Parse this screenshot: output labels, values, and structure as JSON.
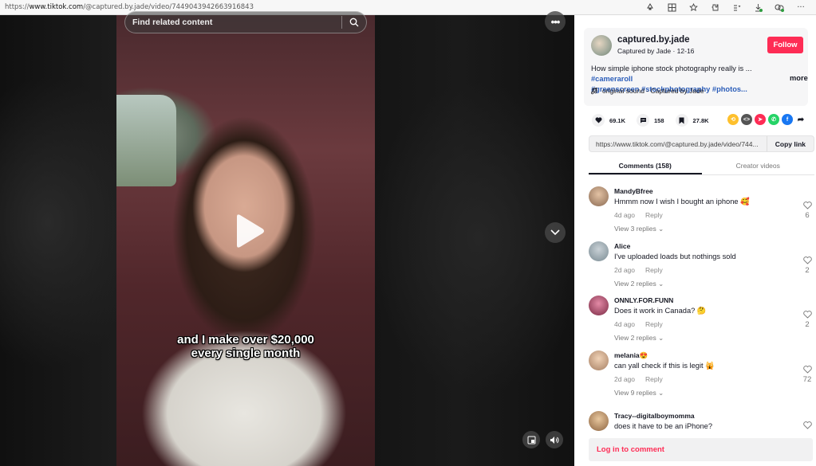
{
  "browser": {
    "url_prefix": "https://",
    "url_host": "www.tiktok.com",
    "url_path": "/@captured.by.jade/video/7449043942663916843"
  },
  "video": {
    "search_placeholder": "Find related content",
    "caption_line1": "and I make over $20,000",
    "caption_line2": "every single month"
  },
  "post": {
    "username": "captured.by.jade",
    "subline": "Captured by Jade · 12-16",
    "follow_label": "Follow",
    "desc_text": "How simple iphone stock photography really is ... ",
    "tags_line1": "#cameraroll",
    "tags_line2": "#greenscreen #stockphotography #photos...",
    "more_label": "more",
    "sound": "original sound - Captured by Jade"
  },
  "stats": {
    "likes": "69.1K",
    "comments": "158",
    "saves": "27.8K"
  },
  "share": {
    "link": "https://www.tiktok.com/@captured.by.jade/video/744...",
    "copy_label": "Copy link"
  },
  "tabs": [
    {
      "label": "Comments (158)"
    },
    {
      "label": "Creator videos"
    }
  ],
  "comments": [
    {
      "user": "MandyBfree",
      "text": "Hmmm now I wish I bought an iphone 🥰",
      "age": "4d ago",
      "reply": "Reply",
      "replies": "View 3 replies ⌄",
      "likes": "6"
    },
    {
      "user": "Alice",
      "text": "I've uploaded loads but nothings sold",
      "age": "2d ago",
      "reply": "Reply",
      "replies": "View 2 replies ⌄",
      "likes": "2"
    },
    {
      "user": "ONNLY.FOR.FUNN",
      "text": "Does it work in Canada? 🤔",
      "age": "4d ago",
      "reply": "Reply",
      "replies": "View 2 replies ⌄",
      "likes": "2"
    },
    {
      "user": "melania😍",
      "text": "can yall check if this is legit 🙀",
      "age": "2d ago",
      "reply": "Reply",
      "replies": "View 9 replies ⌄",
      "likes": "72"
    },
    {
      "user": "Tracy--digitalboymomma",
      "text": "does it have to be an iPhone?",
      "age": "",
      "reply": "",
      "replies": "",
      "likes": ""
    }
  ],
  "login_label": "Log in to comment",
  "colors": {
    "accent": "#fe2c55",
    "hashtag": "#2b5db9"
  }
}
